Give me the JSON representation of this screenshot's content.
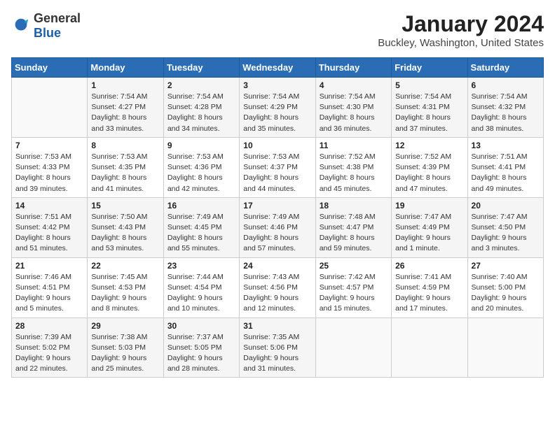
{
  "logo": {
    "general": "General",
    "blue": "Blue"
  },
  "header": {
    "title": "January 2024",
    "subtitle": "Buckley, Washington, United States"
  },
  "weekdays": [
    "Sunday",
    "Monday",
    "Tuesday",
    "Wednesday",
    "Thursday",
    "Friday",
    "Saturday"
  ],
  "weeks": [
    [
      {
        "day": "",
        "info": ""
      },
      {
        "day": "1",
        "info": "Sunrise: 7:54 AM\nSunset: 4:27 PM\nDaylight: 8 hours\nand 33 minutes."
      },
      {
        "day": "2",
        "info": "Sunrise: 7:54 AM\nSunset: 4:28 PM\nDaylight: 8 hours\nand 34 minutes."
      },
      {
        "day": "3",
        "info": "Sunrise: 7:54 AM\nSunset: 4:29 PM\nDaylight: 8 hours\nand 35 minutes."
      },
      {
        "day": "4",
        "info": "Sunrise: 7:54 AM\nSunset: 4:30 PM\nDaylight: 8 hours\nand 36 minutes."
      },
      {
        "day": "5",
        "info": "Sunrise: 7:54 AM\nSunset: 4:31 PM\nDaylight: 8 hours\nand 37 minutes."
      },
      {
        "day": "6",
        "info": "Sunrise: 7:54 AM\nSunset: 4:32 PM\nDaylight: 8 hours\nand 38 minutes."
      }
    ],
    [
      {
        "day": "7",
        "info": "Sunrise: 7:53 AM\nSunset: 4:33 PM\nDaylight: 8 hours\nand 39 minutes."
      },
      {
        "day": "8",
        "info": "Sunrise: 7:53 AM\nSunset: 4:35 PM\nDaylight: 8 hours\nand 41 minutes."
      },
      {
        "day": "9",
        "info": "Sunrise: 7:53 AM\nSunset: 4:36 PM\nDaylight: 8 hours\nand 42 minutes."
      },
      {
        "day": "10",
        "info": "Sunrise: 7:53 AM\nSunset: 4:37 PM\nDaylight: 8 hours\nand 44 minutes."
      },
      {
        "day": "11",
        "info": "Sunrise: 7:52 AM\nSunset: 4:38 PM\nDaylight: 8 hours\nand 45 minutes."
      },
      {
        "day": "12",
        "info": "Sunrise: 7:52 AM\nSunset: 4:39 PM\nDaylight: 8 hours\nand 47 minutes."
      },
      {
        "day": "13",
        "info": "Sunrise: 7:51 AM\nSunset: 4:41 PM\nDaylight: 8 hours\nand 49 minutes."
      }
    ],
    [
      {
        "day": "14",
        "info": "Sunrise: 7:51 AM\nSunset: 4:42 PM\nDaylight: 8 hours\nand 51 minutes."
      },
      {
        "day": "15",
        "info": "Sunrise: 7:50 AM\nSunset: 4:43 PM\nDaylight: 8 hours\nand 53 minutes."
      },
      {
        "day": "16",
        "info": "Sunrise: 7:49 AM\nSunset: 4:45 PM\nDaylight: 8 hours\nand 55 minutes."
      },
      {
        "day": "17",
        "info": "Sunrise: 7:49 AM\nSunset: 4:46 PM\nDaylight: 8 hours\nand 57 minutes."
      },
      {
        "day": "18",
        "info": "Sunrise: 7:48 AM\nSunset: 4:47 PM\nDaylight: 8 hours\nand 59 minutes."
      },
      {
        "day": "19",
        "info": "Sunrise: 7:47 AM\nSunset: 4:49 PM\nDaylight: 9 hours\nand 1 minute."
      },
      {
        "day": "20",
        "info": "Sunrise: 7:47 AM\nSunset: 4:50 PM\nDaylight: 9 hours\nand 3 minutes."
      }
    ],
    [
      {
        "day": "21",
        "info": "Sunrise: 7:46 AM\nSunset: 4:51 PM\nDaylight: 9 hours\nand 5 minutes."
      },
      {
        "day": "22",
        "info": "Sunrise: 7:45 AM\nSunset: 4:53 PM\nDaylight: 9 hours\nand 8 minutes."
      },
      {
        "day": "23",
        "info": "Sunrise: 7:44 AM\nSunset: 4:54 PM\nDaylight: 9 hours\nand 10 minutes."
      },
      {
        "day": "24",
        "info": "Sunrise: 7:43 AM\nSunset: 4:56 PM\nDaylight: 9 hours\nand 12 minutes."
      },
      {
        "day": "25",
        "info": "Sunrise: 7:42 AM\nSunset: 4:57 PM\nDaylight: 9 hours\nand 15 minutes."
      },
      {
        "day": "26",
        "info": "Sunrise: 7:41 AM\nSunset: 4:59 PM\nDaylight: 9 hours\nand 17 minutes."
      },
      {
        "day": "27",
        "info": "Sunrise: 7:40 AM\nSunset: 5:00 PM\nDaylight: 9 hours\nand 20 minutes."
      }
    ],
    [
      {
        "day": "28",
        "info": "Sunrise: 7:39 AM\nSunset: 5:02 PM\nDaylight: 9 hours\nand 22 minutes."
      },
      {
        "day": "29",
        "info": "Sunrise: 7:38 AM\nSunset: 5:03 PM\nDaylight: 9 hours\nand 25 minutes."
      },
      {
        "day": "30",
        "info": "Sunrise: 7:37 AM\nSunset: 5:05 PM\nDaylight: 9 hours\nand 28 minutes."
      },
      {
        "day": "31",
        "info": "Sunrise: 7:35 AM\nSunset: 5:06 PM\nDaylight: 9 hours\nand 31 minutes."
      },
      {
        "day": "",
        "info": ""
      },
      {
        "day": "",
        "info": ""
      },
      {
        "day": "",
        "info": ""
      }
    ]
  ]
}
